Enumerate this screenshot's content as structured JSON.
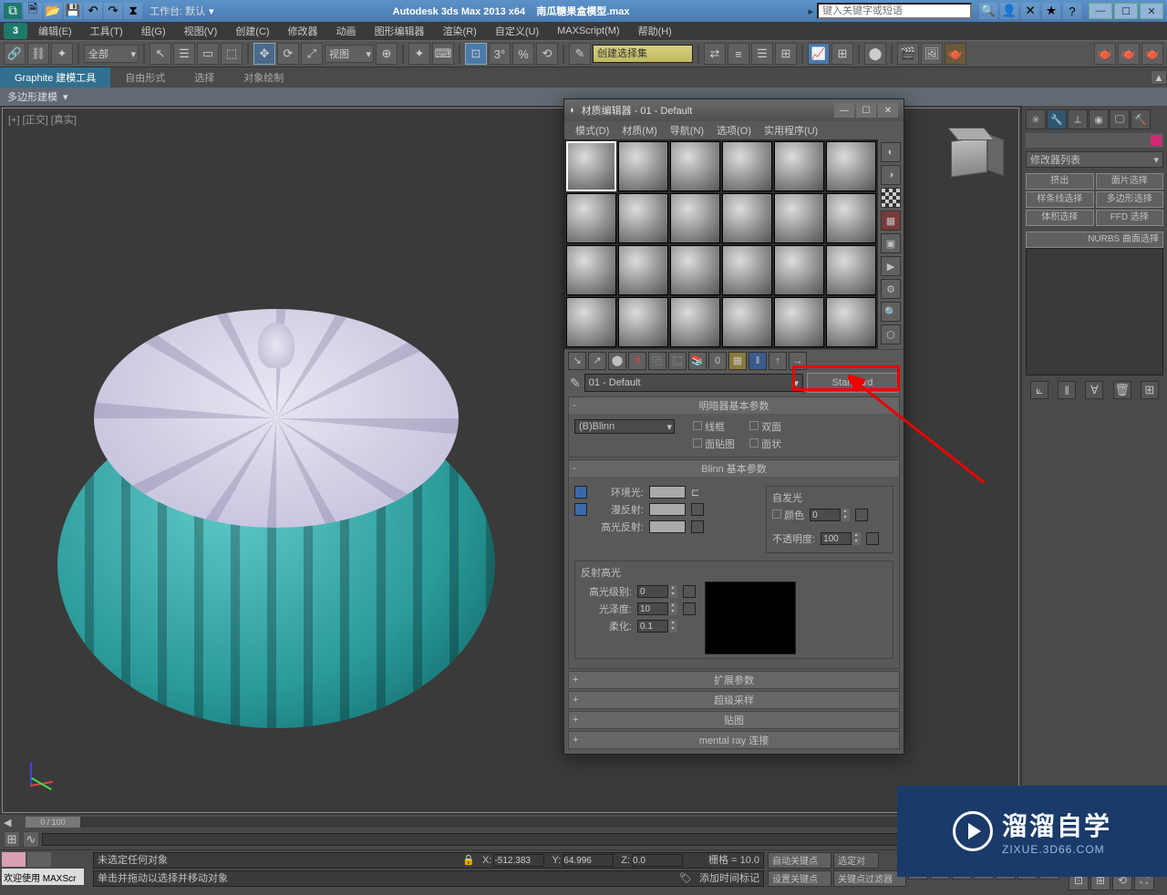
{
  "titlebar": {
    "workspace_label": "工作台: 默认",
    "app": "Autodesk 3ds Max  2013 x64",
    "filename": "南瓜糖果盒模型.max",
    "search_placeholder": "键入关键字或短语"
  },
  "menus": [
    "编辑(E)",
    "工具(T)",
    "组(G)",
    "视图(V)",
    "创建(C)",
    "修改器",
    "动画",
    "图形编辑器",
    "渲染(R)",
    "自定义(U)",
    "MAXScript(M)",
    "帮助(H)"
  ],
  "toolbar": {
    "selection_filter": "全部",
    "view_dropdown": "视图",
    "named_sel": "创建选择集"
  },
  "ribbon": {
    "tabs": [
      "Graphite 建模工具",
      "自由形式",
      "选择",
      "对象绘制"
    ],
    "sub": "多边形建模"
  },
  "viewport": {
    "label": "[+] [正交] [真实]"
  },
  "cmd_panel": {
    "dropdown": "修改器列表",
    "buttons": [
      "挤出",
      "面片选择",
      "样条线选择",
      "多边形选择",
      "体积选择",
      "FFD 选择"
    ],
    "nurbs": "NURBS 曲面选择"
  },
  "material_editor": {
    "title": "材质编辑器 - 01 - Default",
    "menus": [
      "模式(D)",
      "材质(M)",
      "导航(N)",
      "选项(O)",
      "实用程序(U)"
    ],
    "name": "01 - Default",
    "type_button": "Standard",
    "rollout_shader": {
      "title": "明暗器基本参数",
      "shader": "(B)Blinn",
      "wire": "线框",
      "two_sided": "双面",
      "face_map": "面贴图",
      "faceted": "面状"
    },
    "rollout_blinn": {
      "title": "Blinn 基本参数",
      "ambient": "环境光:",
      "diffuse": "漫反射:",
      "specular": "高光反射:",
      "self_illum_group": "自发光",
      "self_illum_color": "颜色",
      "self_illum_val": "0",
      "opacity_label": "不透明度:",
      "opacity_val": "100",
      "spec_group": "反射高光",
      "spec_level_label": "高光级别:",
      "spec_level_val": "0",
      "gloss_label": "光泽度:",
      "gloss_val": "10",
      "soften_label": "柔化:",
      "soften_val": "0.1"
    },
    "rollouts_collapsed": [
      "扩展参数",
      "超级采样",
      "贴图",
      "mental ray 连接"
    ]
  },
  "timeline": {
    "thumb": "0 / 100"
  },
  "status": {
    "welcome": "欢迎使用",
    "script": "MAXScr",
    "sel": "未选定任何对象",
    "hint": "单击并拖动以选择并移动对象",
    "x": "-512.383",
    "y": "64.996",
    "z": "0.0",
    "grid": "栅格 = 10.0",
    "add_time_tag": "添加时间标记",
    "autokey": "自动关键点",
    "setkey": "设置关键点",
    "selected_label": "选定对",
    "keyfilter": "关键点过滤器"
  },
  "watermark": {
    "cn": "溜溜自学",
    "en": "ZIXUE.3D66.COM"
  }
}
